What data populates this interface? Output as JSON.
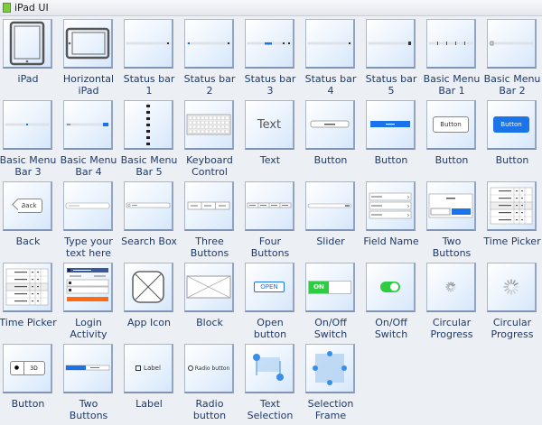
{
  "window": {
    "title": "iPad UI"
  },
  "items": [
    {
      "label": "iPad",
      "icon": "ipad"
    },
    {
      "label": "Horizontal iPad",
      "icon": "hipad"
    },
    {
      "label": "Status bar 1",
      "icon": "status1"
    },
    {
      "label": "Status bar 2",
      "icon": "status2"
    },
    {
      "label": "Status bar 3",
      "icon": "status3"
    },
    {
      "label": "Status bar 4",
      "icon": "status1"
    },
    {
      "label": "Status bar 5",
      "icon": "status5"
    },
    {
      "label": "Basic Menu Bar 1",
      "icon": "menubar1"
    },
    {
      "label": "Basic Menu Bar 2",
      "icon": "menubar2"
    },
    {
      "label": "Basic Menu Bar 3",
      "icon": "menubar3"
    },
    {
      "label": "Basic Menu Bar 4",
      "icon": "menubar4"
    },
    {
      "label": "Basic Menu Bar 5",
      "icon": "menubar5"
    },
    {
      "label": "Keyboard Control",
      "icon": "keyboard"
    },
    {
      "label": "Text",
      "icon": "text",
      "text": "Text"
    },
    {
      "label": "Button",
      "icon": "btnsmall"
    },
    {
      "label": "Button",
      "icon": "btnbluebar"
    },
    {
      "label": "Button",
      "icon": "btnwhite",
      "text": "Button"
    },
    {
      "label": "Button",
      "icon": "btnblue",
      "text": "Button"
    },
    {
      "label": "Back",
      "icon": "back",
      "text": "Back"
    },
    {
      "label": "Type your text here",
      "icon": "input"
    },
    {
      "label": "Search Box",
      "icon": "search"
    },
    {
      "label": "Three Buttons",
      "icon": "three"
    },
    {
      "label": "Four Buttons",
      "icon": "four"
    },
    {
      "label": "Slider",
      "icon": "slider"
    },
    {
      "label": "Field Name",
      "icon": "fields"
    },
    {
      "label": "Two Buttons",
      "icon": "twobtn"
    },
    {
      "label": "Time Picker",
      "icon": "timepicker"
    },
    {
      "label": "Time Picker",
      "icon": "timepicker"
    },
    {
      "label": "Login Activity",
      "icon": "login"
    },
    {
      "label": "App Icon",
      "icon": "appicon"
    },
    {
      "label": "Block",
      "icon": "block"
    },
    {
      "label": "Open button",
      "icon": "open",
      "text": "OPEN"
    },
    {
      "label": "On/Off Switch",
      "icon": "onoff",
      "text": "ON"
    },
    {
      "label": "On/Off Switch",
      "icon": "toggle"
    },
    {
      "label": "Circular Progress",
      "icon": "spinner"
    },
    {
      "label": "Circular Progress",
      "icon": "spinner2"
    },
    {
      "label": "Button",
      "icon": "segbtn",
      "text": "3D"
    },
    {
      "label": "Two Buttons",
      "icon": "twobar"
    },
    {
      "label": "Label",
      "icon": "label",
      "text": "Label"
    },
    {
      "label": "Radio button",
      "icon": "radio",
      "text": "Radio button"
    },
    {
      "label": "Text Selection",
      "icon": "textsel"
    },
    {
      "label": "Selection Frame",
      "icon": "selframe"
    }
  ],
  "colors": {
    "label": "#1f3a68",
    "accent": "#1a73e8",
    "green": "#2ecc40",
    "orange": "#ff6a13"
  }
}
